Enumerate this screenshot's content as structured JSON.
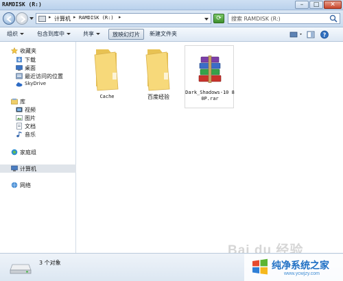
{
  "window": {
    "title": "RAMDISK (R:)",
    "minimize_glyph": "–",
    "maximize_glyph": "□",
    "close_glyph": "✕"
  },
  "address": {
    "crumbs": [
      "计算机",
      "RAMDISK (R:)"
    ],
    "separator": "▸",
    "search_placeholder": "搜索 RAMDISK (R:)"
  },
  "toolbar": {
    "items": [
      "组织",
      "包含到库中",
      "共享",
      "放映幻灯片",
      "新建文件夹"
    ],
    "selected": "放映幻灯片"
  },
  "navigation": {
    "favorites": {
      "label": "收藏夹",
      "items": [
        "下载",
        "桌面",
        "最近访问的位置",
        "SkyDrive"
      ]
    },
    "libraries": {
      "label": "库",
      "items": [
        "视频",
        "图片",
        "文档",
        "音乐"
      ]
    },
    "homegroup": "家庭组",
    "computer": "计算机",
    "network": "网络"
  },
  "files": [
    {
      "name": "Cache",
      "type": "folder"
    },
    {
      "name": "百度经验",
      "type": "folder"
    },
    {
      "name": "Dark_Shadows-1080P.rar",
      "display_name": "Dark_Shadows-10 80P.rar",
      "type": "rar-archive"
    }
  ],
  "status": {
    "text": "3 个对象"
  },
  "watermark": {
    "text": "Bai du 经验"
  },
  "brand": {
    "name": "纯净系统之家",
    "url": "www.ycwjzy.com"
  },
  "colors": {
    "folder": "#f5d36b",
    "selection": "#dfe4ea",
    "brand_blue": "#1f6fc4"
  }
}
